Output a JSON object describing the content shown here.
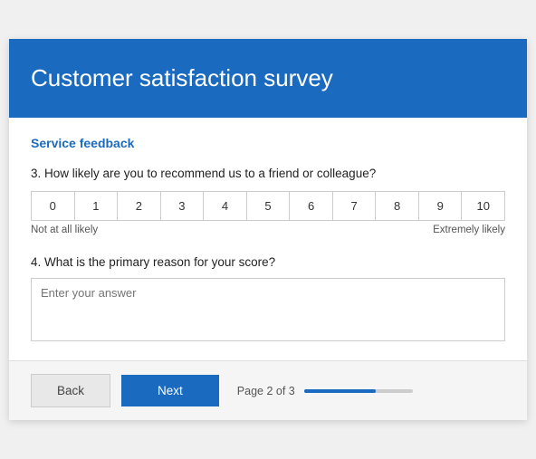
{
  "header": {
    "title": "Customer satisfaction survey"
  },
  "section": {
    "label": "Service feedback"
  },
  "questions": [
    {
      "number": "3.",
      "text": "How likely are you to recommend us to a friend or colleague?",
      "scale": {
        "options": [
          "0",
          "1",
          "2",
          "3",
          "4",
          "5",
          "6",
          "7",
          "8",
          "9",
          "10"
        ],
        "label_left": "Not at all likely",
        "label_right": "Extremely likely"
      }
    },
    {
      "number": "4.",
      "text": "What is the primary reason for your score?",
      "placeholder": "Enter your answer"
    }
  ],
  "footer": {
    "back_label": "Back",
    "next_label": "Next",
    "page_text": "Page 2 of 3",
    "progress_percent": 66
  }
}
